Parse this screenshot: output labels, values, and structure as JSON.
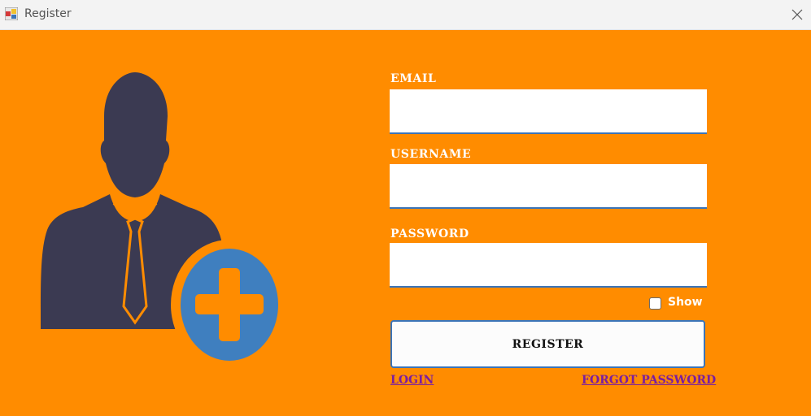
{
  "window": {
    "title": "Register",
    "app_icon": "app-icon",
    "close_icon": "close-icon"
  },
  "form": {
    "email_label": "EMAIL",
    "email_value": "",
    "username_label": "USERNAME",
    "username_value": "",
    "password_label": "PASSWORD",
    "password_value": "",
    "show_label": "Show",
    "show_checked": false,
    "register_label": "REGISTER",
    "login_link": "LOGIN",
    "forgot_link": "FORGOT PASSWORD"
  },
  "illustration": {
    "icon": "add-user-icon",
    "silhouette_color": "#3b3a52",
    "badge_color": "#3f7fbf"
  },
  "colors": {
    "background": "#ff8c00",
    "field_border": "#3b74b8",
    "link": "#7a1ea0"
  }
}
